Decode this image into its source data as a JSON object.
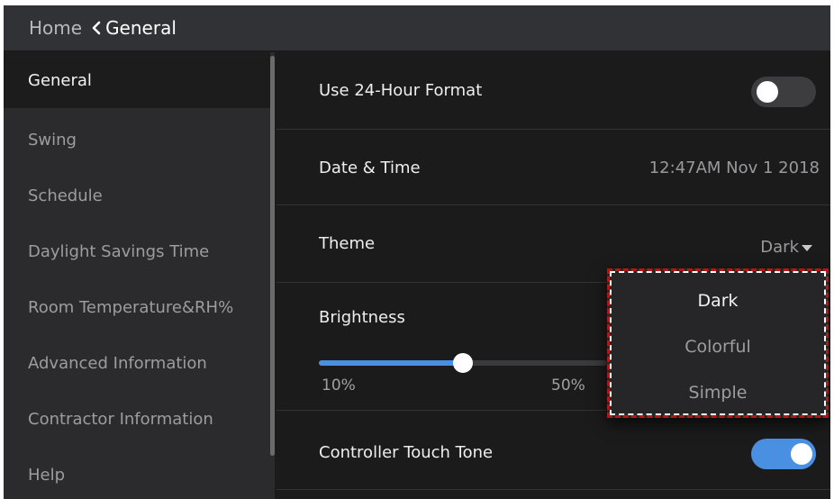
{
  "header": {
    "home_label": "Home",
    "current_label": "General"
  },
  "sidebar": {
    "items": [
      {
        "label": "General",
        "active": true
      },
      {
        "label": "Swing"
      },
      {
        "label": "Schedule"
      },
      {
        "label": "Daylight Savings Time"
      },
      {
        "label": "Room Temperature&RH%"
      },
      {
        "label": "Advanced Information"
      },
      {
        "label": "Contractor Information"
      },
      {
        "label": "Help"
      }
    ]
  },
  "settings": {
    "hour_format": {
      "label": "Use 24-Hour Format",
      "enabled": false
    },
    "date_time": {
      "label": "Date & Time",
      "value": "12:47AM Nov 1 2018"
    },
    "theme": {
      "label": "Theme",
      "value": "Dark"
    },
    "brightness": {
      "label": "Brightness",
      "level": 0.5,
      "tick_min": "10%",
      "tick_mid": "50%"
    },
    "touch_tone": {
      "label": "Controller Touch Tone",
      "enabled": true
    }
  },
  "theme_dropdown": {
    "options": [
      "Dark",
      "Colorful",
      "Simple"
    ],
    "selected": "Dark"
  },
  "colors": {
    "accent": "#4a90e2",
    "highlight_border": "#b01818"
  }
}
